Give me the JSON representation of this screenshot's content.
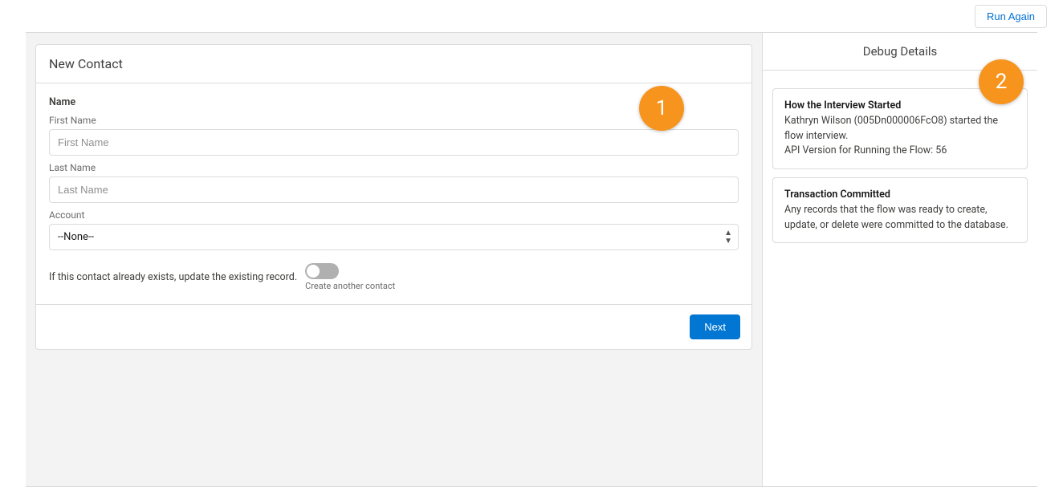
{
  "topbar": {
    "run_again": "Run Again"
  },
  "form": {
    "card_title": "New Contact",
    "section_name": "Name",
    "first_name_label": "First Name",
    "first_name_placeholder": "First Name",
    "last_name_label": "Last Name",
    "last_name_placeholder": "Last Name",
    "account_label": "Account",
    "account_value": "--None--",
    "toggle_text": "If this contact already exists, update the existing record.",
    "toggle_caption": "Create another contact",
    "next_label": "Next"
  },
  "debug": {
    "header": "Debug Details",
    "cards": [
      {
        "title": "How the Interview Started",
        "line1": "Kathryn Wilson (005Dn000006FcO8) started the flow interview.",
        "line2": "API Version for Running the Flow: 56"
      },
      {
        "title": "Transaction Committed",
        "line1": "Any records that the flow was ready to create, update, or delete were committed to the database.",
        "line2": ""
      }
    ]
  },
  "callouts": {
    "one": "1",
    "two": "2"
  }
}
